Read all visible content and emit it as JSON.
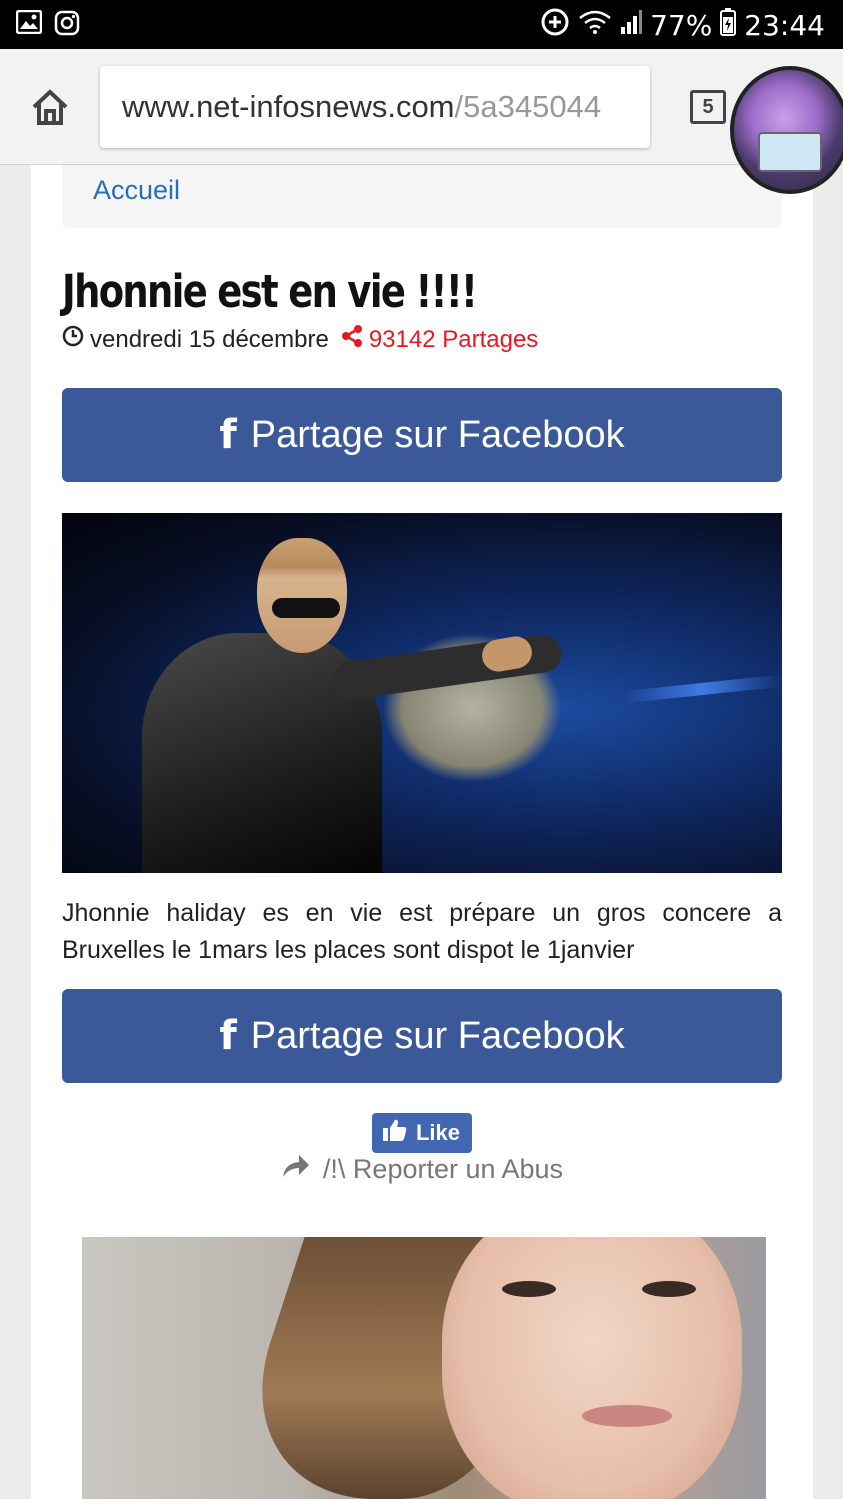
{
  "status_bar": {
    "battery": "77%",
    "time": "23:44"
  },
  "browser": {
    "url_domain": "www.net-infosnews.com",
    "url_path": "/5a345044",
    "tabs_count": "5"
  },
  "breadcrumb": {
    "home_label": "Accueil"
  },
  "article": {
    "title": "Jhonnie est en vie !!!!",
    "date": "vendredi 15 décembre",
    "shares": "93142 Partages",
    "share_button_label": "Partage sur Facebook",
    "body": "Jhonnie haliday es en vie est prépare un gros concere a Bruxelles le 1mars les places sont dispot le 1janvier",
    "like_label": "Like",
    "report_label": "/!\\ Reporter un Abus"
  },
  "colors": {
    "facebook_blue": "#3b5998",
    "shares_red": "#e8191d",
    "link_blue": "#2a6fb5"
  },
  "icons": {
    "home": "home-icon",
    "clock": "clock-icon",
    "share": "share-icon",
    "facebook": "facebook-f-icon",
    "like": "thumbs-up-icon",
    "report": "forward-arrow-icon"
  }
}
